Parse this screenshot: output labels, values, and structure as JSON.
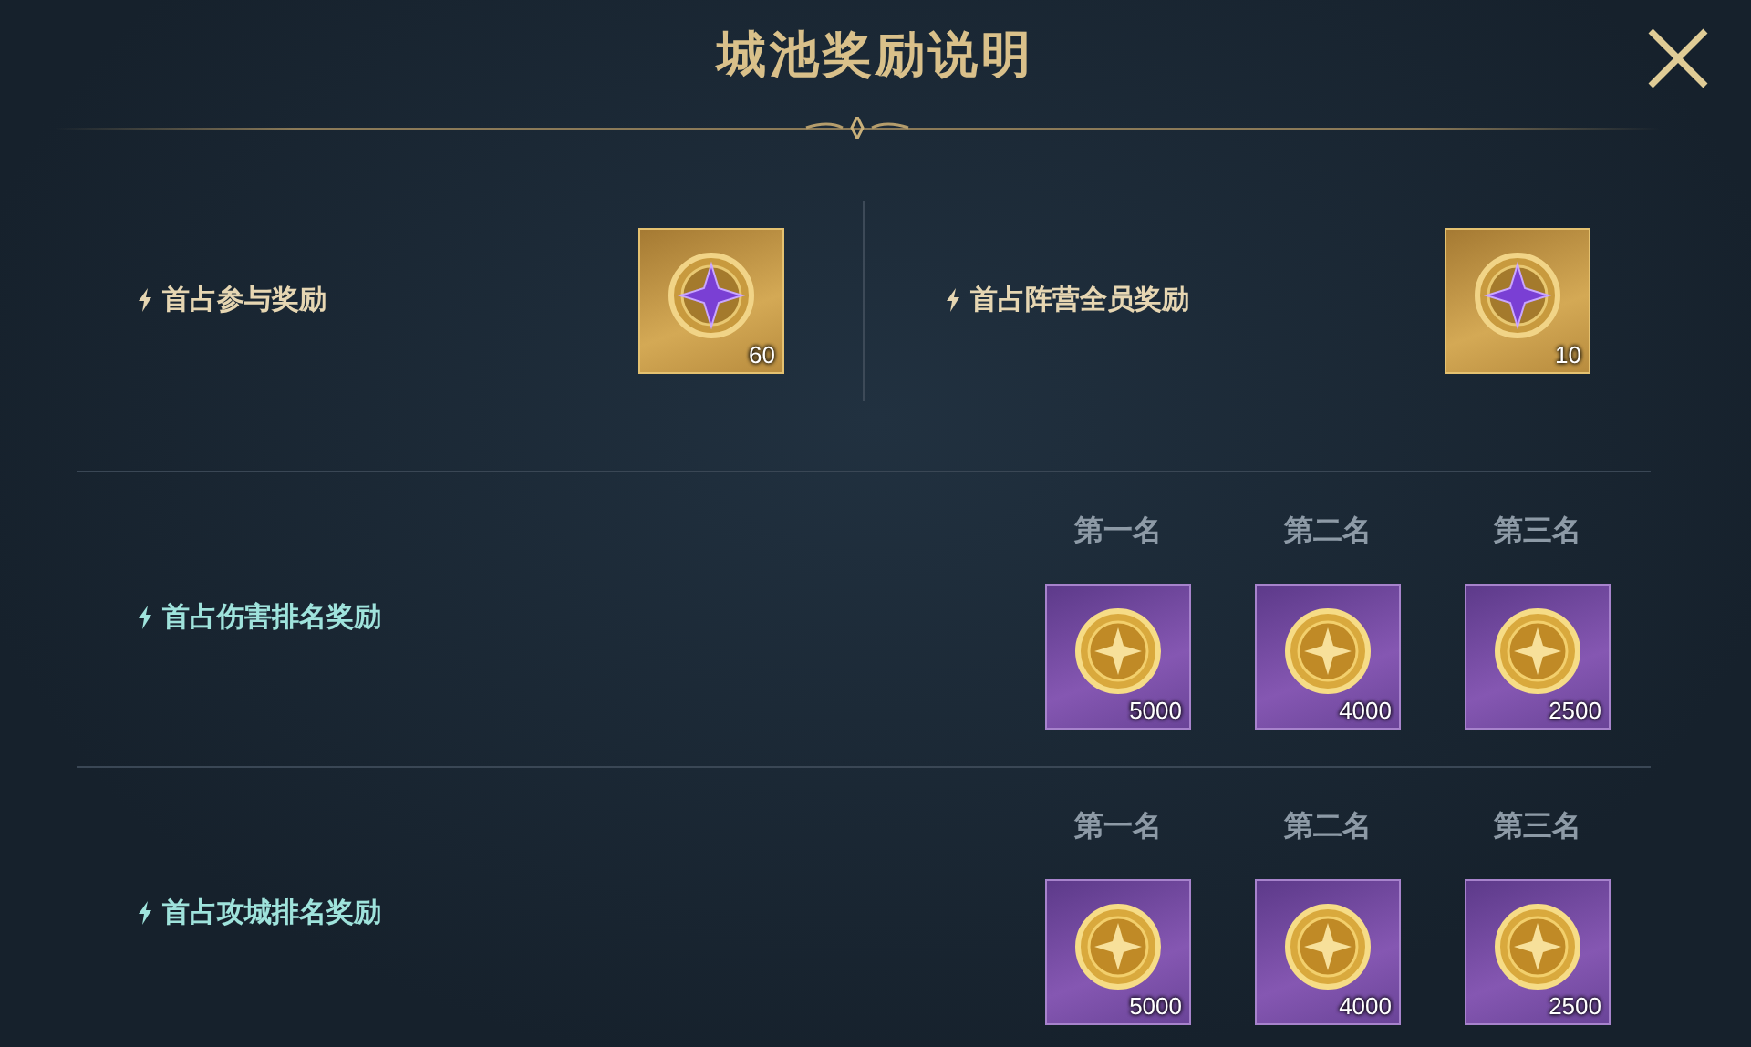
{
  "title": "城池奖励说明",
  "top_rewards": [
    {
      "label": "首占参与奖励",
      "item": {
        "kind": "gem",
        "count": "60"
      }
    },
    {
      "label": "首占阵营全员奖励",
      "item": {
        "kind": "gem",
        "count": "10"
      }
    }
  ],
  "ranked_rewards": [
    {
      "label": "首占伤害排名奖励",
      "ranks": [
        {
          "rank": "第一名",
          "item": {
            "kind": "coin",
            "count": "5000"
          }
        },
        {
          "rank": "第二名",
          "item": {
            "kind": "coin",
            "count": "4000"
          }
        },
        {
          "rank": "第三名",
          "item": {
            "kind": "coin",
            "count": "2500"
          }
        }
      ]
    },
    {
      "label": "首占攻城排名奖励",
      "ranks": [
        {
          "rank": "第一名",
          "item": {
            "kind": "coin",
            "count": "5000"
          }
        },
        {
          "rank": "第二名",
          "item": {
            "kind": "coin",
            "count": "4000"
          }
        },
        {
          "rank": "第三名",
          "item": {
            "kind": "coin",
            "count": "2500"
          }
        }
      ]
    }
  ]
}
